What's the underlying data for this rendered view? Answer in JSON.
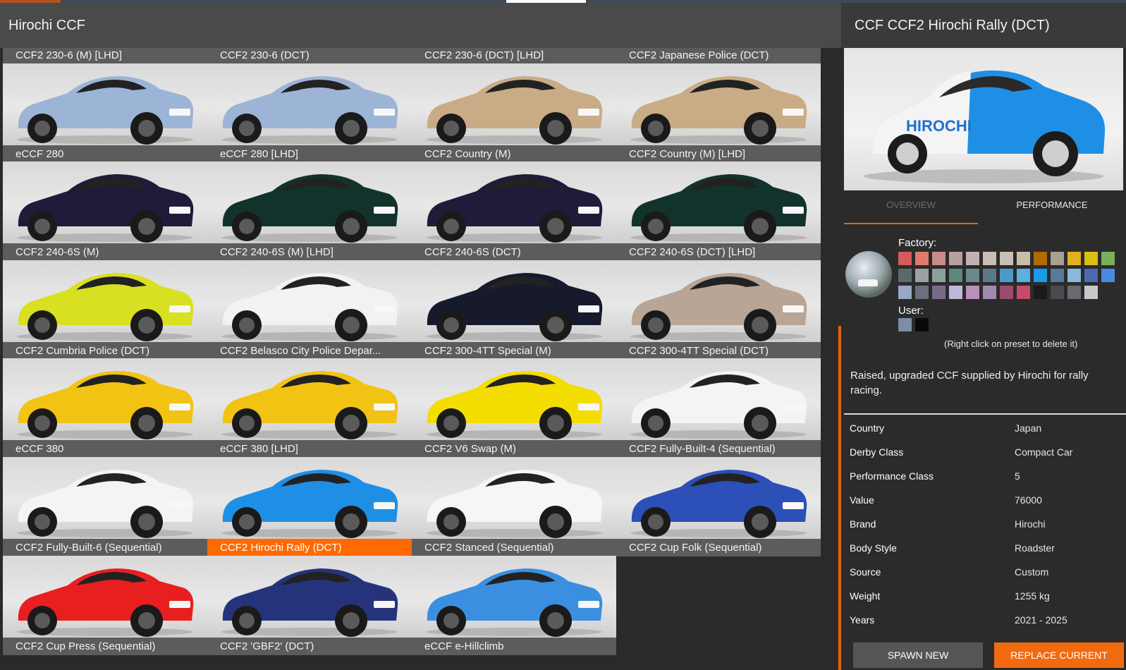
{
  "left_title": "Hirochi CCF",
  "right_title": "CCF CCF2 Hirochi Rally (DCT)",
  "colors": {
    "accent": "#ff6a00",
    "panel": "#2b2b2b",
    "tile_label": "#5c5c5c"
  },
  "models": [
    {
      "label": "CCF2 230-6 (M) [LHD]",
      "color": "#7f9bbd"
    },
    {
      "label": "CCF2 230-6 (DCT)",
      "color": "#7f9bbd"
    },
    {
      "label": "CCF2 230-6 (DCT) [LHD]",
      "color": "#6b6b6b"
    },
    {
      "label": "CCF2 Japanese Police (DCT)",
      "color": "#6b6b6b"
    },
    {
      "label": "eCCF 280",
      "color": "#9cb4d6"
    },
    {
      "label": "eCCF 280 [LHD]",
      "color": "#9cb4d6"
    },
    {
      "label": "CCF2 Country (M)",
      "color": "#c9ac86"
    },
    {
      "label": "CCF2 Country (M) [LHD]",
      "color": "#c9ac86"
    },
    {
      "label": "CCF2 240-6S (M)",
      "color": "#1f1c3a"
    },
    {
      "label": "CCF2 240-6S (M) [LHD]",
      "color": "#12332b"
    },
    {
      "label": "CCF2 240-6S (DCT)",
      "color": "#1f1c3a"
    },
    {
      "label": "CCF2 240-6S (DCT) [LHD]",
      "color": "#12332b"
    },
    {
      "label": "CCF2 Cumbria Police (DCT)",
      "color": "#d8e021"
    },
    {
      "label": "CCF2 Belasco City Police Depar...",
      "color": "#f2f2f2"
    },
    {
      "label": "CCF2 300-4TT Special (M)",
      "color": "#161a2c"
    },
    {
      "label": "CCF2 300-4TT Special (DCT)",
      "color": "#b8a596"
    },
    {
      "label": "eCCF 380",
      "color": "#f2c313"
    },
    {
      "label": "eCCF 380 [LHD]",
      "color": "#f2c313"
    },
    {
      "label": "CCF2 V6 Swap (M)",
      "color": "#f4dd00"
    },
    {
      "label": "CCF2 Fully-Built-4 (Sequential)",
      "color": "#f4f4f4"
    },
    {
      "label": "CCF2 Fully-Built-6 (Sequential)",
      "color": "#f4f4f4"
    },
    {
      "label": "CCF2 Hirochi Rally (DCT)",
      "color": "#1f8fe6"
    },
    {
      "label": "CCF2 Stanced (Sequential)",
      "color": "#f6f6f6"
    },
    {
      "label": "CCF2 Cup Folk (Sequential)",
      "color": "#2c4fb8"
    },
    {
      "label": "CCF2 Cup Press (Sequential)",
      "color": "#e81f1f"
    },
    {
      "label": "CCF2 'GBF2' (DCT)",
      "color": "#25347a"
    },
    {
      "label": "eCCF e-Hillclimb",
      "color": "#3a8fe0"
    }
  ],
  "selected_model": "CCF2 Hirochi Rally (DCT)",
  "tabs": [
    {
      "label": "OVERVIEW",
      "active": true
    },
    {
      "label": "PERFORMANCE",
      "active": false
    }
  ],
  "paints": {
    "factory_label": "Factory:",
    "user_label": "User:",
    "hint": "(Right click on preset to delete it)",
    "factory_colors": [
      "#d95a5a",
      "#e07a6a",
      "#c88a8a",
      "#b8a0a0",
      "#c4b0b0",
      "#c8bcb4",
      "#c8c0b8",
      "#c8bea8",
      "#b06a00",
      "#a8a090",
      "#e0b020",
      "#d8c010",
      "#7ab05a",
      "#5a6a6a",
      "#9aa2a2",
      "#8aa09a",
      "#5a8a7a",
      "#6a8a8a",
      "#5a7a8a",
      "#4a9ac8",
      "#5ab0e0",
      "#1a9ae8",
      "#5a7a9a",
      "#8ab8d8",
      "#4a6ab0",
      "#4a8ae0",
      "#9aa8c8",
      "#6a7080",
      "#7a6a8a",
      "#c0b8d8",
      "#b890b8",
      "#a08ab0",
      "#9a4a6a",
      "#c84a6a",
      "#1a1a1a",
      "#4a4a50",
      "#6a6a70",
      "#c8c8c8"
    ],
    "user_colors": [
      "#7a8ea6",
      "#0a0a0a"
    ]
  },
  "description": "Raised, upgraded CCF supplied by Hirochi for rally racing.",
  "specs": [
    {
      "key": "Country",
      "value": "Japan"
    },
    {
      "key": "Derby Class",
      "value": "Compact Car"
    },
    {
      "key": "Performance Class",
      "value": "5"
    },
    {
      "key": "Value",
      "value": "76000"
    },
    {
      "key": "Brand",
      "value": "Hirochi"
    },
    {
      "key": "Body Style",
      "value": "Roadster"
    },
    {
      "key": "Source",
      "value": "Custom"
    },
    {
      "key": "Weight",
      "value": "1255 kg"
    },
    {
      "key": "Years",
      "value": "2021 - 2025"
    }
  ],
  "buttons": {
    "spawn": "SPAWN NEW",
    "replace": "REPLACE CURRENT"
  }
}
